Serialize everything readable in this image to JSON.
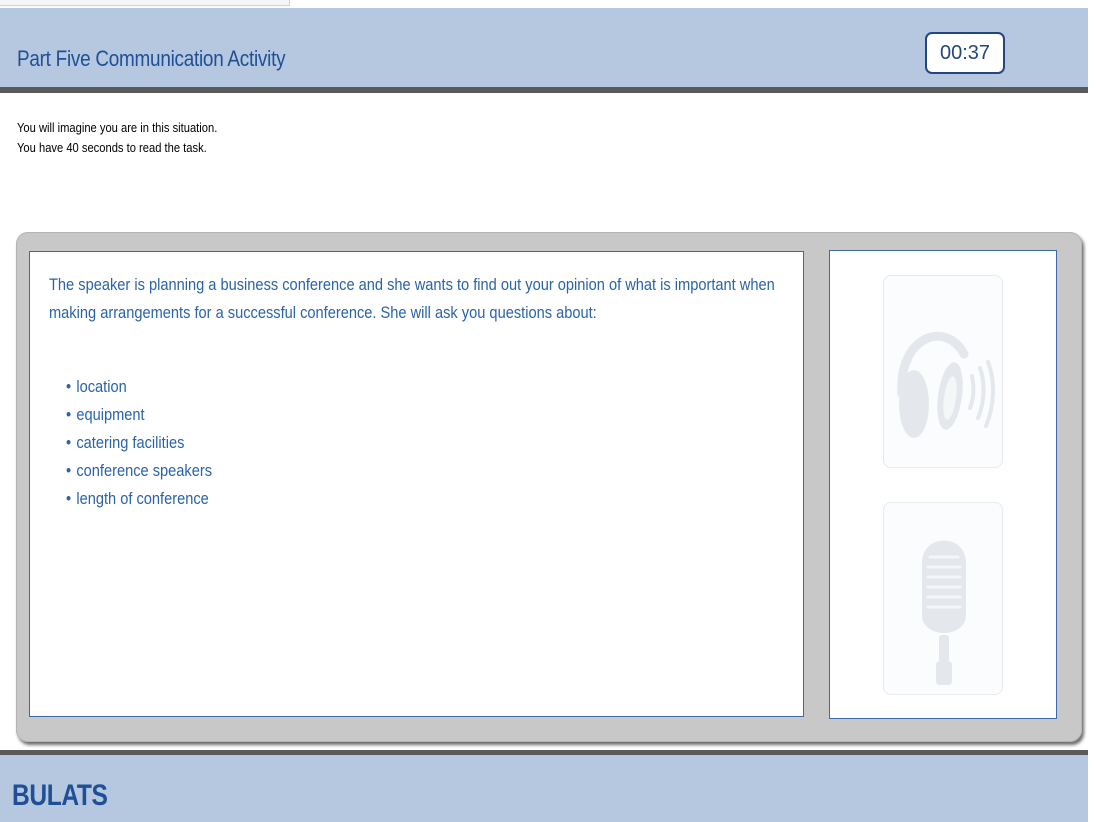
{
  "header": {
    "title": "Part Five  Communication Activity",
    "timer": "00:37"
  },
  "intro": {
    "line1": "You will imagine you are in this situation.",
    "line2": "You have 40 seconds to read the task."
  },
  "task": {
    "description": "The speaker is planning a business conference and she wants to find out your opinion of what is important when making arrangements for a successful conference.  She will ask you questions about:",
    "topics": [
      "location",
      "equipment",
      "catering facilities",
      "conference speakers",
      "length of conference"
    ]
  },
  "icons": {
    "listen": "headphones-icon",
    "speak": "microphone-icon",
    "state": "inactive"
  },
  "footer": {
    "brand": "BULATS"
  },
  "colors": {
    "header_bg": "#b5c8e0",
    "title_text": "#1f4f96",
    "task_text": "#2a63a8",
    "divider": "#5a5a5a",
    "panel_bg": "#c8c8c8"
  }
}
